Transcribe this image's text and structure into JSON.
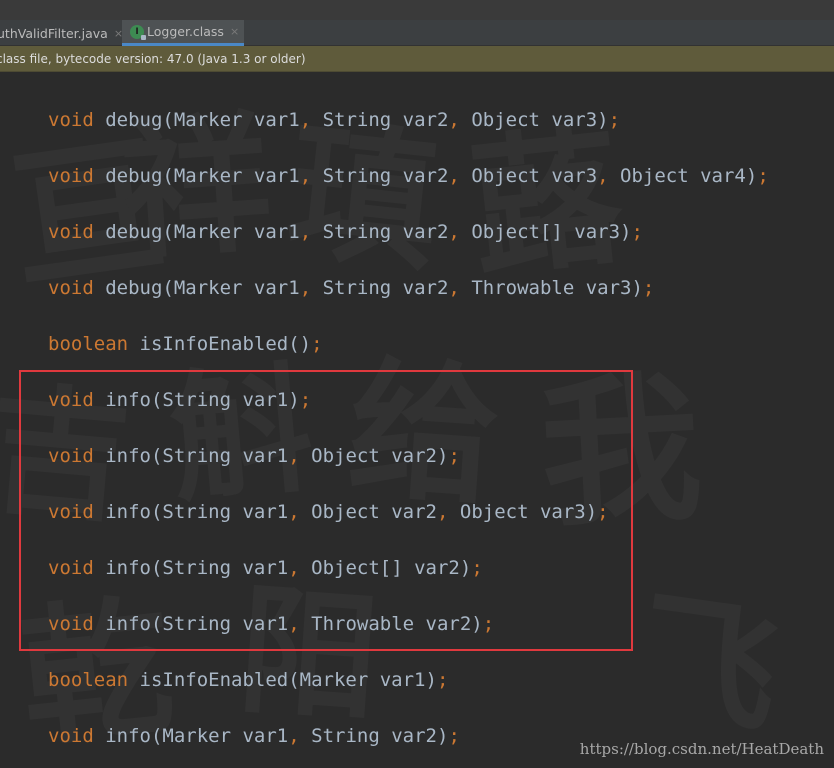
{
  "tabs": [
    {
      "label": "uthValidFilter.java",
      "active": false
    },
    {
      "label": "Logger.class",
      "active": true
    }
  ],
  "tab_close_glyph": "×",
  "notice": {
    "text": "class file, bytecode version: 47.0 (Java 1.3 or older)"
  },
  "code_lines": [
    {
      "type": "void",
      "name": "debug",
      "params": [
        [
          "Marker",
          "var1"
        ],
        [
          "String",
          "var2"
        ],
        [
          "Object",
          "var3"
        ]
      ]
    },
    {
      "type": "void",
      "name": "debug",
      "params": [
        [
          "Marker",
          "var1"
        ],
        [
          "String",
          "var2"
        ],
        [
          "Object",
          "var3"
        ],
        [
          "Object",
          "var4"
        ]
      ]
    },
    {
      "type": "void",
      "name": "debug",
      "params": [
        [
          "Marker",
          "var1"
        ],
        [
          "String",
          "var2"
        ],
        [
          "Object[]",
          "var3"
        ]
      ]
    },
    {
      "type": "void",
      "name": "debug",
      "params": [
        [
          "Marker",
          "var1"
        ],
        [
          "String",
          "var2"
        ],
        [
          "Throwable",
          "var3"
        ]
      ]
    },
    {
      "type": "boolean",
      "name": "isInfoEnabled",
      "params": []
    },
    {
      "type": "void",
      "name": "info",
      "params": [
        [
          "String",
          "var1"
        ]
      ]
    },
    {
      "type": "void",
      "name": "info",
      "params": [
        [
          "String",
          "var1"
        ],
        [
          "Object",
          "var2"
        ]
      ]
    },
    {
      "type": "void",
      "name": "info",
      "params": [
        [
          "String",
          "var1"
        ],
        [
          "Object",
          "var2"
        ],
        [
          "Object",
          "var3"
        ]
      ]
    },
    {
      "type": "void",
      "name": "info",
      "params": [
        [
          "String",
          "var1"
        ],
        [
          "Object[]",
          "var2"
        ]
      ]
    },
    {
      "type": "void",
      "name": "info",
      "params": [
        [
          "String",
          "var1"
        ],
        [
          "Throwable",
          "var2"
        ]
      ]
    },
    {
      "type": "boolean",
      "name": "isInfoEnabled",
      "params": [
        [
          "Marker",
          "var1"
        ]
      ]
    },
    {
      "type": "void",
      "name": "info",
      "params": [
        [
          "Marker",
          "var1"
        ],
        [
          "String",
          "var2"
        ]
      ]
    }
  ],
  "watermark_url": "https://blog.csdn.net/HeatDeath",
  "colors": {
    "editor_bg": "#2b2b2b",
    "keyword": "#cc7832",
    "text": "#a9b7c6",
    "notice_bg": "#5f5b3b",
    "highlight_border": "#e0393e"
  },
  "icons": {
    "class_file": "class-file-icon",
    "close": "close-icon"
  }
}
